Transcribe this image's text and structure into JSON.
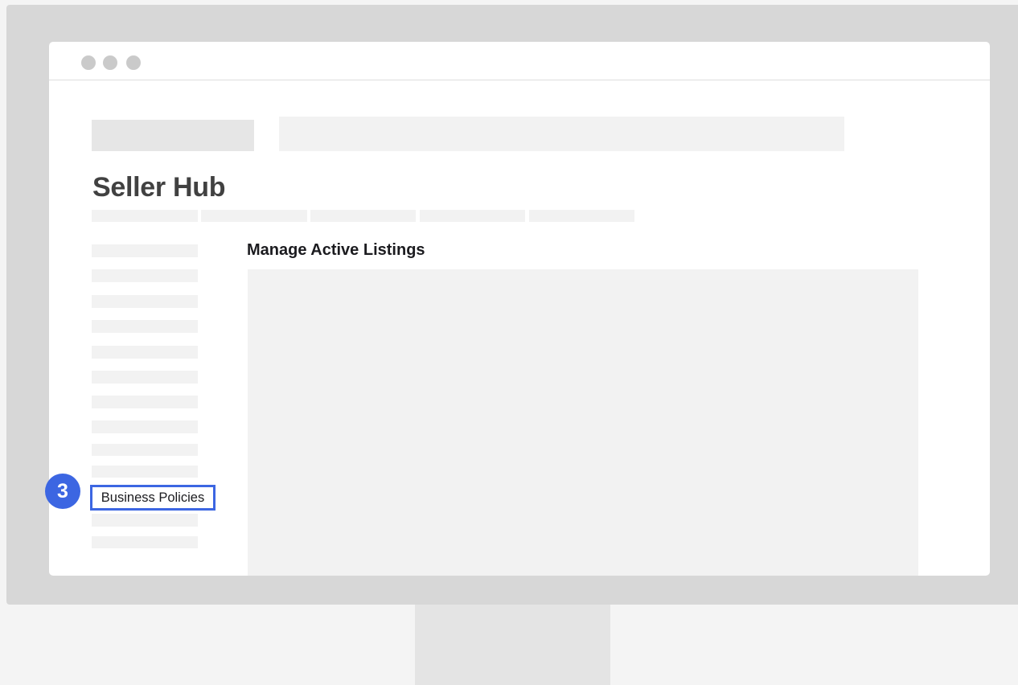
{
  "page": {
    "title": "Seller Hub",
    "section_title": "Manage Active Listings"
  },
  "sidebar": {
    "highlighted_item": "Business Policies"
  },
  "callout": {
    "step_number": "3"
  },
  "colors": {
    "accent": "#3c66e2",
    "monitor_bezel": "#d7d7d7",
    "placeholder": "#f2f2f2"
  }
}
